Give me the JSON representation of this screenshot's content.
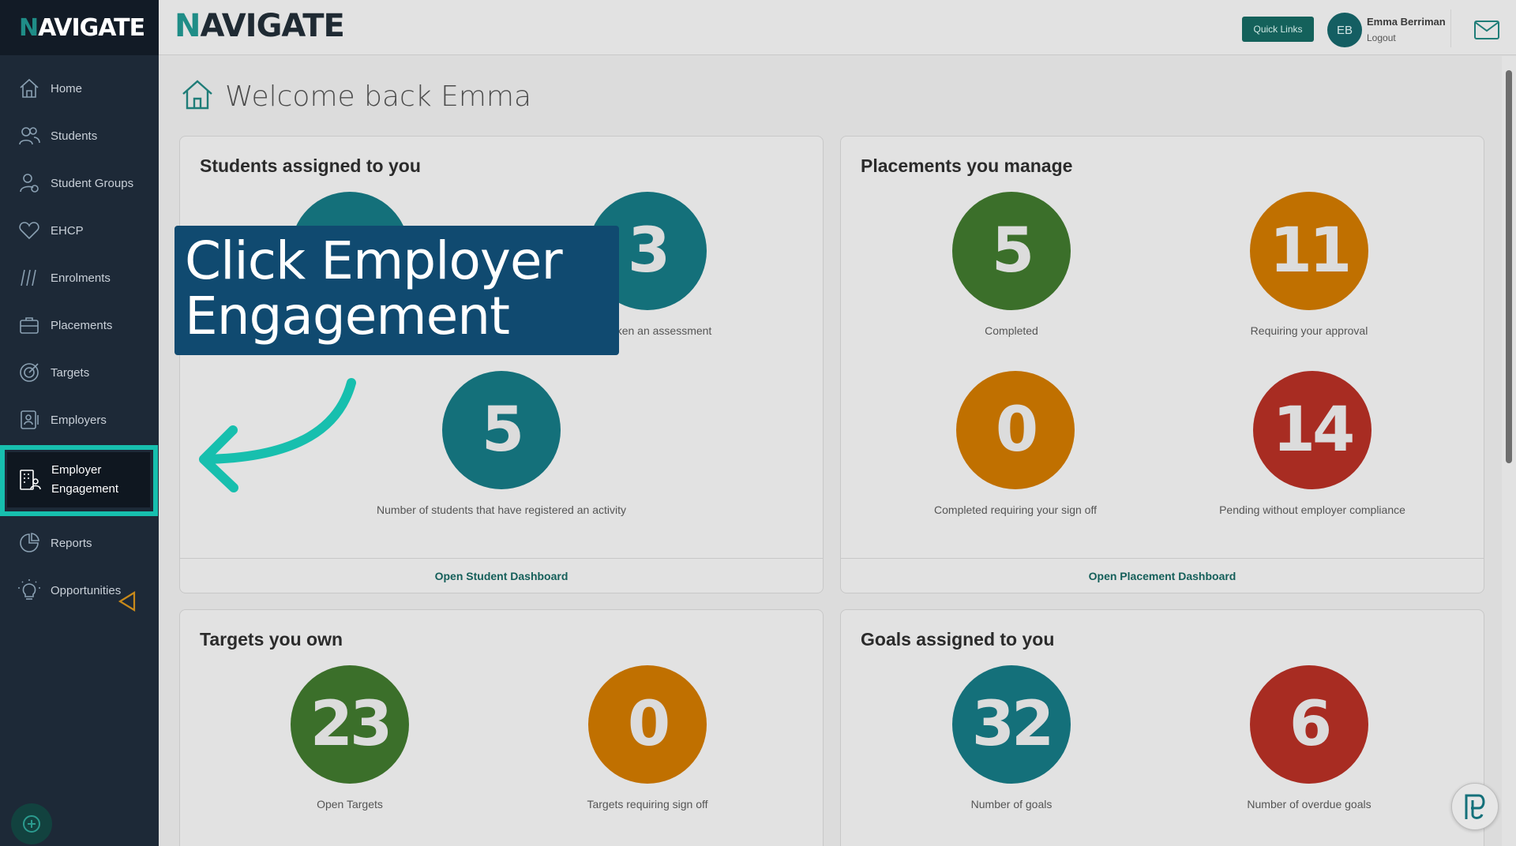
{
  "brand": {
    "name_initial": "N",
    "name_rest": "AVIGATE"
  },
  "sidebar": {
    "items": [
      {
        "label": "Home",
        "icon": "home-icon"
      },
      {
        "label": "Students",
        "icon": "users-icon"
      },
      {
        "label": "Student Groups",
        "icon": "user-group-icon"
      },
      {
        "label": "EHCP",
        "icon": "heart-icon"
      },
      {
        "label": "Enrolments",
        "icon": "enrolments-icon"
      },
      {
        "label": "Placements",
        "icon": "briefcase-icon"
      },
      {
        "label": "Targets",
        "icon": "target-icon"
      },
      {
        "label": "Employers",
        "icon": "employer-badge-icon"
      },
      {
        "label_line1": "Employer",
        "label_line2": "Engagement",
        "icon": "building-person-icon",
        "active": true
      },
      {
        "label": "Reports",
        "icon": "pie-chart-icon"
      },
      {
        "label": "Opportunities",
        "icon": "lightbulb-icon"
      }
    ]
  },
  "header": {
    "quick_links": "Quick Links",
    "avatar_initials": "EB",
    "user_name": "Emma Berriman",
    "logout": "Logout"
  },
  "page": {
    "title": "Welcome back Emma"
  },
  "cards": {
    "students": {
      "title": "Students assigned to you",
      "stat1_value": "",
      "stat1_label": "",
      "stat2_value": "3",
      "stat2_label": "ents taken an assessment",
      "stat3_value": "5",
      "stat3_label": "Number of students that have registered an activity",
      "footer": "Open Student Dashboard"
    },
    "placements": {
      "title": "Placements you manage",
      "stat1_value": "5",
      "stat1_label": "Completed",
      "stat2_value": "11",
      "stat2_label": "Requiring your approval",
      "stat3_value": "0",
      "stat3_label": "Completed requiring your sign off",
      "stat4_value": "14",
      "stat4_label": "Pending without employer compliance",
      "footer": "Open Placement Dashboard"
    },
    "targets": {
      "title": "Targets you own",
      "stat1_value": "23",
      "stat1_label": "Open Targets",
      "stat2_value": "0",
      "stat2_label": "Targets requiring sign off"
    },
    "goals": {
      "title": "Goals assigned to you",
      "stat1_value": "32",
      "stat1_label": "Number of goals",
      "stat2_value": "6",
      "stat2_label": "Number of overdue goals"
    }
  },
  "callout": {
    "line1": "Click Employer",
    "line2": "Engagement"
  },
  "colors": {
    "teal": "#14707a",
    "green": "#3b6f2a",
    "orange": "#c07000",
    "red": "#a82c22",
    "highlight": "#17bfae",
    "callout_bg": "#104a70"
  }
}
